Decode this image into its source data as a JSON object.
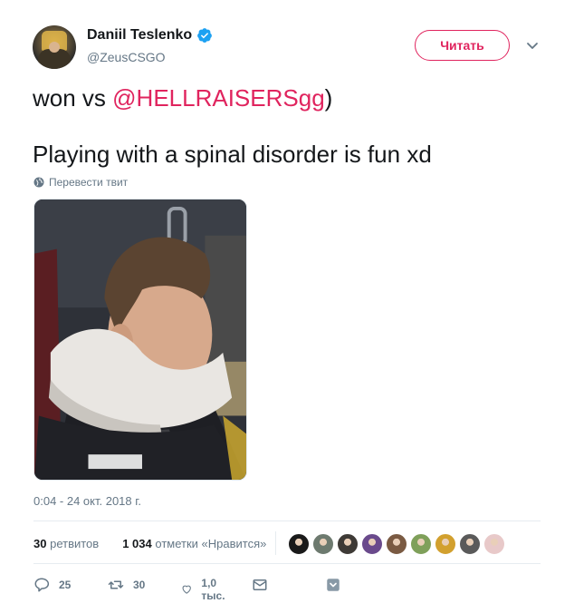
{
  "user": {
    "display_name": "Daniil Teslenko",
    "handle": "@ZeusCSGO",
    "verified": true,
    "avatar_icon": "avatar-image"
  },
  "follow_button": {
    "label": "Читать"
  },
  "tweet": {
    "line1_prefix": "won vs ",
    "line1_mention": "@HELLRAISERSgg",
    "line1_suffix": ")",
    "line2": "Playing with a spinal disorder is fun xd"
  },
  "translate_link": {
    "label": "Перевести твит",
    "icon": "globe-icon"
  },
  "photo": {
    "icon": "tweet-photo"
  },
  "timestamp": "0:04 - 24 окт. 2018 г.",
  "stats": {
    "retweets_count": "30",
    "retweets_label": "ретвитов",
    "likes_count": "1 034",
    "likes_label": "отметки «Нравится»"
  },
  "likers": [
    {
      "color": "#1a1a1a"
    },
    {
      "color": "#6d7a6f"
    },
    {
      "color": "#3e3a36"
    },
    {
      "color": "#6a4a8c"
    },
    {
      "color": "#7a5a42"
    },
    {
      "color": "#7fa05a"
    },
    {
      "color": "#d2a02e"
    },
    {
      "color": "#5a5a5a"
    },
    {
      "color": "#e8c9c9"
    }
  ],
  "actions": {
    "reply_count": "25",
    "retweet_count": "30",
    "like_count": "1,0 тыс.",
    "accent_color": "#657786"
  },
  "colors": {
    "brand": "#e0245e",
    "verified": "#1da1f2",
    "muted": "#657786"
  }
}
